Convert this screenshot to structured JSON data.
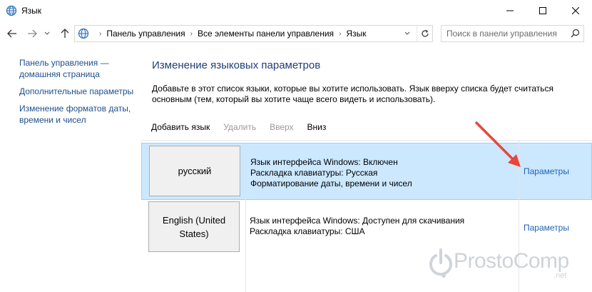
{
  "window": {
    "title": "Язык",
    "accent": "#1f4e8c"
  },
  "address": {
    "crumbs": [
      "Панель управления",
      "Все элементы панели управления",
      "Язык"
    ],
    "search_placeholder": "Поиск в панели управления"
  },
  "sidebar": {
    "items": [
      {
        "label": "Панель управления — домашняя страница"
      },
      {
        "label": "Дополнительные параметры"
      },
      {
        "label": "Изменение форматов даты, времени и чисел"
      }
    ]
  },
  "main": {
    "title": "Изменение языковых параметров",
    "description": "Добавьте в этот список языки, которые вы хотите использовать. Язык вверху списка будет считаться основным (тем, который вы хотите чаще всего видеть и использовать).",
    "toolbar": {
      "add": "Добавить язык",
      "remove": "Удалить",
      "up": "Вверх",
      "down": "Вниз"
    },
    "languages": [
      {
        "name": "русский",
        "info": [
          "Язык интерфейса Windows: Включен",
          "Раскладка клавиатуры: Русская",
          "Форматирование даты, времени и чисел"
        ],
        "options": "Параметры",
        "selected": true
      },
      {
        "name": "English (United States)",
        "info": [
          "Язык интерфейса Windows: Доступен для скачивания",
          "Раскладка клавиатуры: США"
        ],
        "options": "Параметры",
        "selected": false
      }
    ]
  },
  "watermark": {
    "brand": "ProstoComp",
    "suffix": ".net"
  },
  "colors": {
    "selected_row": "#cce8ff",
    "link": "#1f63b8",
    "arrow": "#e8473b"
  }
}
